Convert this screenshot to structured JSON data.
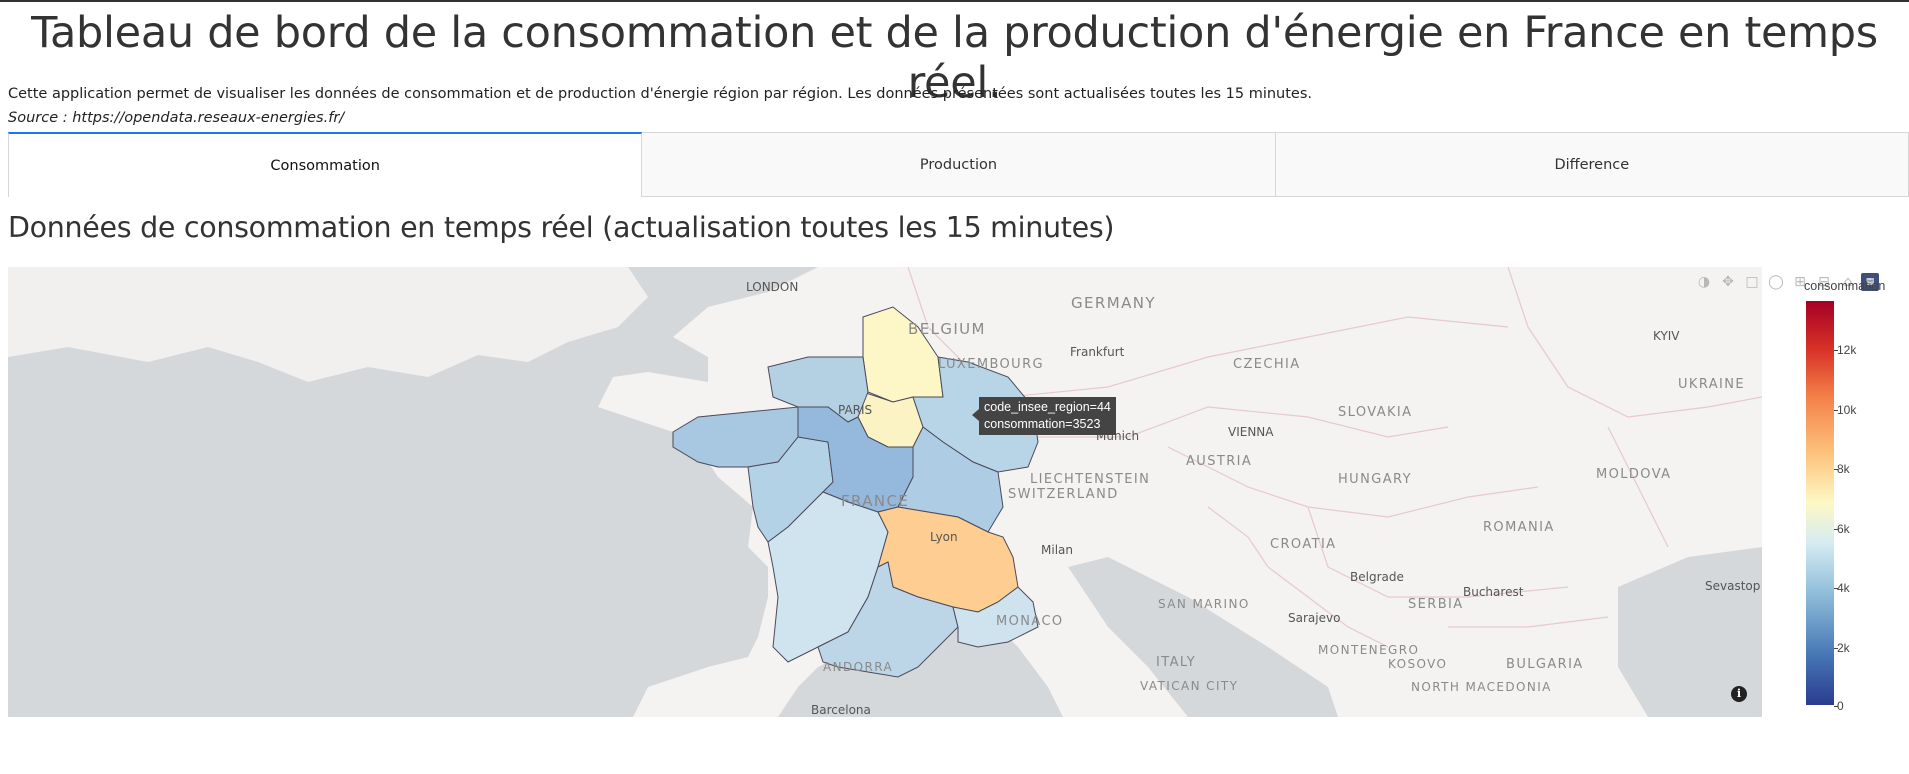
{
  "page": {
    "title": "Tableau de bord de la consommation et de la production d'énergie en France en temps réel.",
    "description": "Cette application permet de visualiser les données de consommation et de production d'énergie région par région. Les données présentées sont actualisées toutes les 15 minutes.",
    "source": "Source : https://opendata.reseaux-energies.fr/"
  },
  "tabs": [
    {
      "label": "Consommation",
      "active": true
    },
    {
      "label": "Production",
      "active": false
    },
    {
      "label": "Difference",
      "active": false
    }
  ],
  "section": {
    "title": "Données de consommation en temps réel (actualisation toutes les 15 minutes)"
  },
  "map": {
    "countries": [
      "GERMANY",
      "BELGIUM",
      "LUXEMBOURG",
      "CZECHIA",
      "UKRAINE",
      "SLOVAKIA",
      "AUSTRIA",
      "HUNGARY",
      "MOLDOVA",
      "LIECHTENSTEIN",
      "SWITZERLAND",
      "ROMANIA",
      "CROATIA",
      "SERBIA",
      "SAN MARINO",
      "MONACO",
      "ITALY",
      "VATICAN CITY",
      "MONTENEGRO",
      "KOSOVO",
      "BULGARIA",
      "NORTH MACEDONIA",
      "ANDORRA",
      "FRANCE"
    ],
    "cities": [
      "LONDON",
      "Frankfurt",
      "Munich",
      "VIENNA",
      "KYIV",
      "Lyon",
      "Milan",
      "Belgrade",
      "Bucharest",
      "Sevastop",
      "Sarajevo",
      "Barcelona",
      "PARIS"
    ],
    "tooltip": {
      "line1": "code_insee_region=44",
      "line2": "consommation=3523"
    },
    "info_icon": "i"
  },
  "modebar": {
    "icons": [
      "camera-icon",
      "pan-icon",
      "box-select-icon",
      "lasso-icon",
      "zoom-in-icon",
      "zoom-out-icon",
      "home-icon",
      "plotly-logo-icon"
    ]
  },
  "colorbar": {
    "title": "consommation",
    "ticks": [
      "12k",
      "10k",
      "8k",
      "6k",
      "4k",
      "2k",
      "0"
    ],
    "colors": [
      "#2a3c8f",
      "#4575b4",
      "#91bfdb",
      "#d6ebf2",
      "#fdf8c4",
      "#fdc47e",
      "#f4824a",
      "#d83228",
      "#a50026"
    ]
  },
  "chart_data": {
    "type": "choropleth",
    "title": "Données de consommation en temps réel (actualisation toutes les 15 minutes)",
    "colorbar_title": "consommation",
    "colorbar_range": [
      0,
      13500
    ],
    "colorbar_ticks": [
      0,
      2000,
      4000,
      6000,
      8000,
      10000,
      12000
    ],
    "regions": [
      {
        "code_insee_region": 44,
        "consommation": 3523
      }
    ]
  }
}
